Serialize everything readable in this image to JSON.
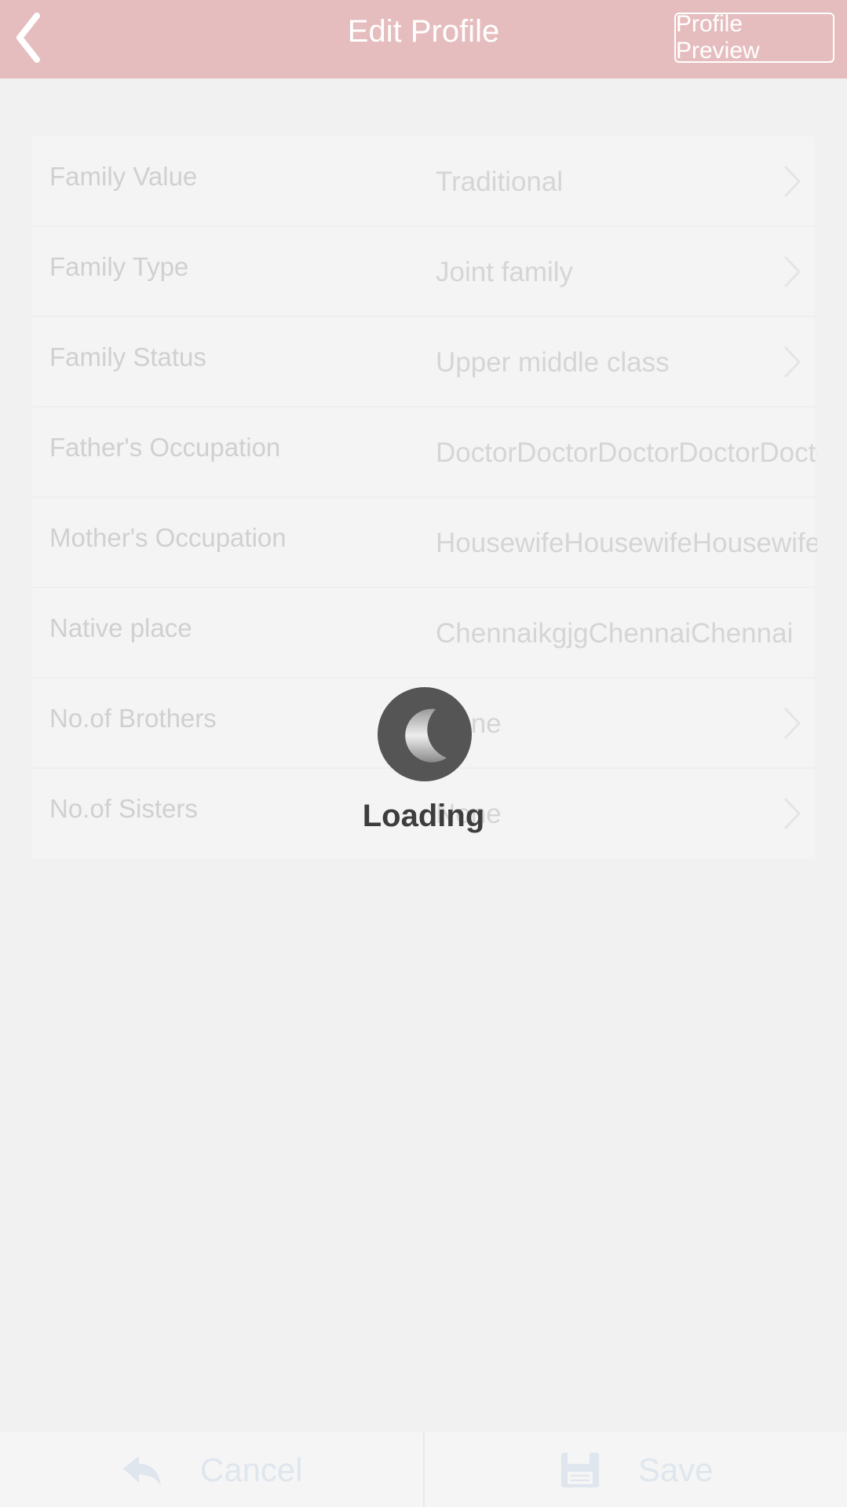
{
  "header": {
    "title": "Edit Profile",
    "preview_label": "Profile Preview",
    "back_icon": "chevron-left-icon",
    "background": "#e6bdbe"
  },
  "rows": [
    {
      "label": "Family Value",
      "value": "Traditional"
    },
    {
      "label": "Family Type",
      "value": "Joint family"
    },
    {
      "label": "Family Status",
      "value": "Upper middle class"
    },
    {
      "label": "Father's Occupation",
      "value": "DoctorDoctorDoctorDoctorDoctor"
    },
    {
      "label": "Mother's Occupation",
      "value": "HousewifeHousewifeHousewife"
    },
    {
      "label": "Native place",
      "value": "ChennaikgjgChennaiChennai"
    },
    {
      "label": "No.of Brothers",
      "value": "None"
    },
    {
      "label": "No.of Sisters",
      "value": "None"
    }
  ],
  "loading": {
    "text": "Loading"
  },
  "footer": {
    "cancel_label": "Cancel",
    "save_label": "Save",
    "cancel_icon": "reply-icon",
    "save_icon": "save-icon"
  }
}
